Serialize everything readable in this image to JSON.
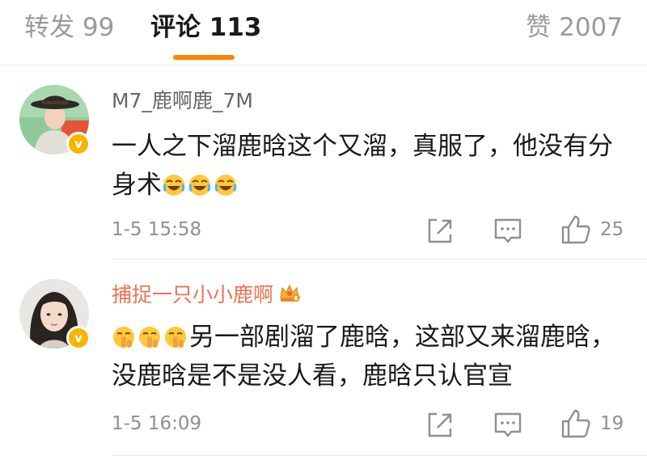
{
  "tabs": {
    "reposts": "转发 99",
    "comments": "评论 113",
    "likes": "赞 2007",
    "active": "comments",
    "accent_color": "#ff8200"
  },
  "comments": [
    {
      "username": "M7_鹿啊鹿_7M",
      "verified": true,
      "avatar_icon": "avatar-man-in-hat",
      "text": "一人之下溜鹿晗这个又溜，真服了，他没有分身术",
      "trailing_emojis": [
        "laugh-cry-emoji",
        "laugh-cry-emoji",
        "laugh-cry-emoji"
      ],
      "timestamp": "1-5 15:58",
      "like_count": "25"
    },
    {
      "username": "捕捉一只小小鹿啊",
      "verified": true,
      "username_color": "#eb7350",
      "badge": {
        "icon": "crown-level-icon",
        "level": "6"
      },
      "avatar_icon": "avatar-woman",
      "leading_emojis": [
        "shush-emoji",
        "shush-emoji",
        "shush-emoji"
      ],
      "text": "另一部剧溜了鹿晗，这部又来溜鹿晗，没鹿晗是不是没人看，鹿晗只认官宣",
      "timestamp": "1-5 16:09",
      "like_count": "19"
    }
  ],
  "icons": {
    "share": "share-icon",
    "reply": "comment-icon",
    "like": "thumbs-up-icon",
    "verified": "verified-badge-icon"
  }
}
